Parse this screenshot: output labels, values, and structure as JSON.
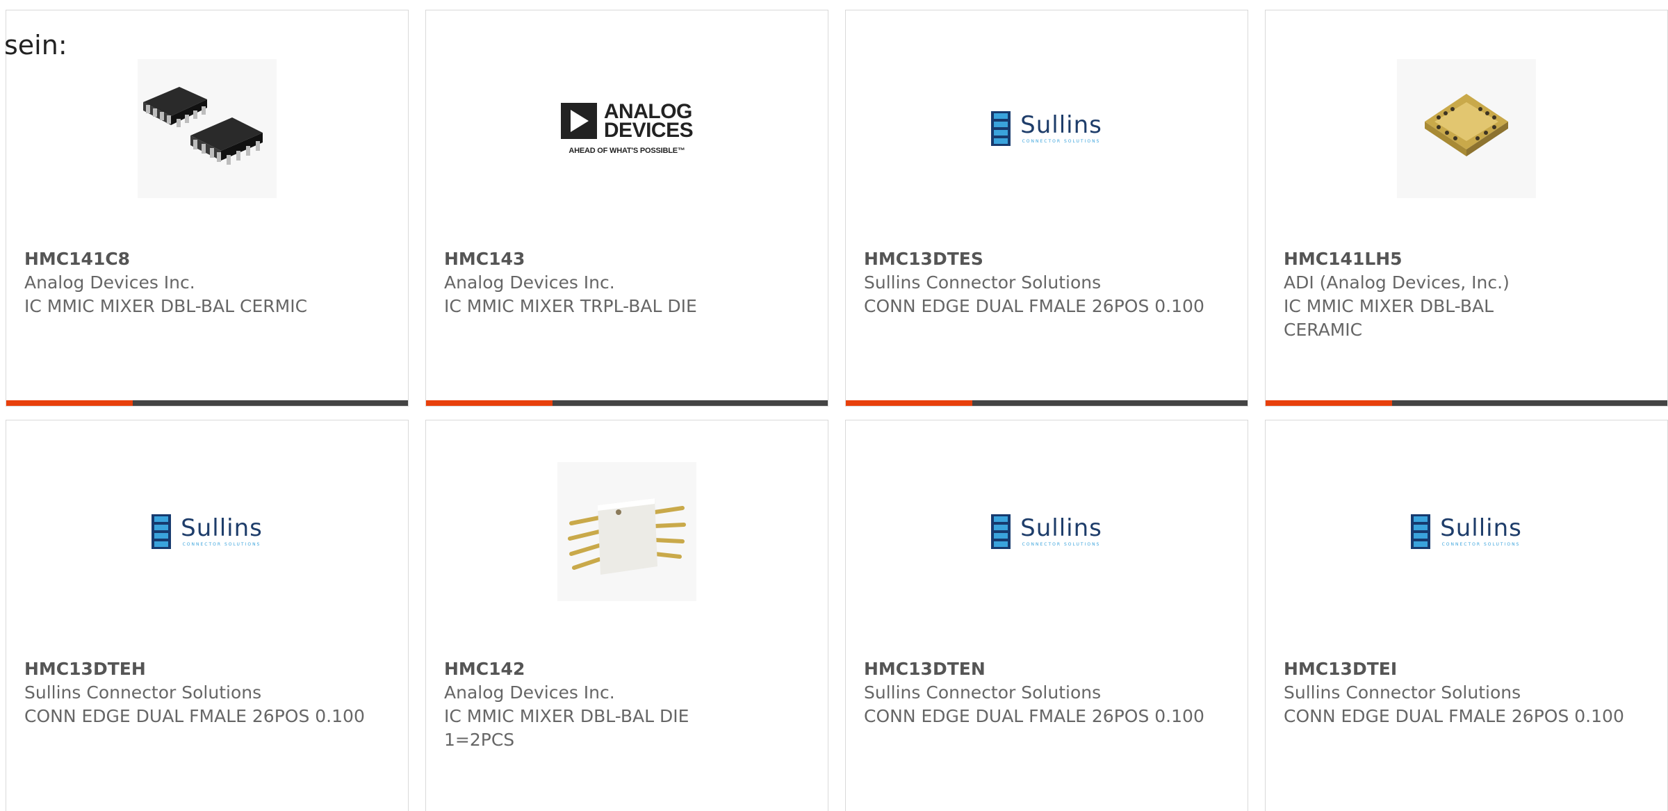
{
  "intro_text": "sein:",
  "logos": {
    "sullins_word": "Sullins",
    "sullins_tag": "CONNECTOR SOLUTIONS",
    "adi_line1": "ANALOG",
    "adi_line2": "DEVICES",
    "adi_tag": "AHEAD OF WHAT'S POSSIBLE™"
  },
  "products": [
    {
      "part_number": "HMC141C8",
      "manufacturer": "Analog Devices Inc.",
      "description": "IC MMIC MIXER DBL-BAL CERMIC",
      "image": "soic-chip-photo"
    },
    {
      "part_number": "HMC143",
      "manufacturer": "Analog Devices Inc.",
      "description": "IC MMIC MIXER TRPL-BAL DIE",
      "image": "analog-devices-logo"
    },
    {
      "part_number": "HMC13DTES",
      "manufacturer": "Sullins Connector Solutions",
      "description": "CONN EDGE DUAL FMALE 26POS 0.100",
      "image": "sullins-logo"
    },
    {
      "part_number": "HMC141LH5",
      "manufacturer": "ADI (Analog Devices, Inc.)",
      "description": "IC MMIC MIXER DBL-BAL CERAMIC",
      "image": "ceramic-package-photo"
    },
    {
      "part_number": "HMC13DTEH",
      "manufacturer": "Sullins Connector Solutions",
      "description": "CONN EDGE DUAL FMALE 26POS 0.100",
      "image": "sullins-logo"
    },
    {
      "part_number": "HMC142",
      "manufacturer": "Analog Devices Inc.",
      "description": "IC MMIC MIXER DBL-BAL DIE 1=2PCS",
      "image": "white-package-photo"
    },
    {
      "part_number": "HMC13DTEN",
      "manufacturer": "Sullins Connector Solutions",
      "description": "CONN EDGE DUAL FMALE 26POS 0.100",
      "image": "sullins-logo"
    },
    {
      "part_number": "HMC13DTEI",
      "manufacturer": "Sullins Connector Solutions",
      "description": "CONN EDGE DUAL FMALE 26POS 0.100",
      "image": "sullins-logo"
    }
  ],
  "colors": {
    "accent": "#e8400c",
    "bar": "#444444",
    "text": "#666666",
    "border": "#d9d9d9"
  }
}
